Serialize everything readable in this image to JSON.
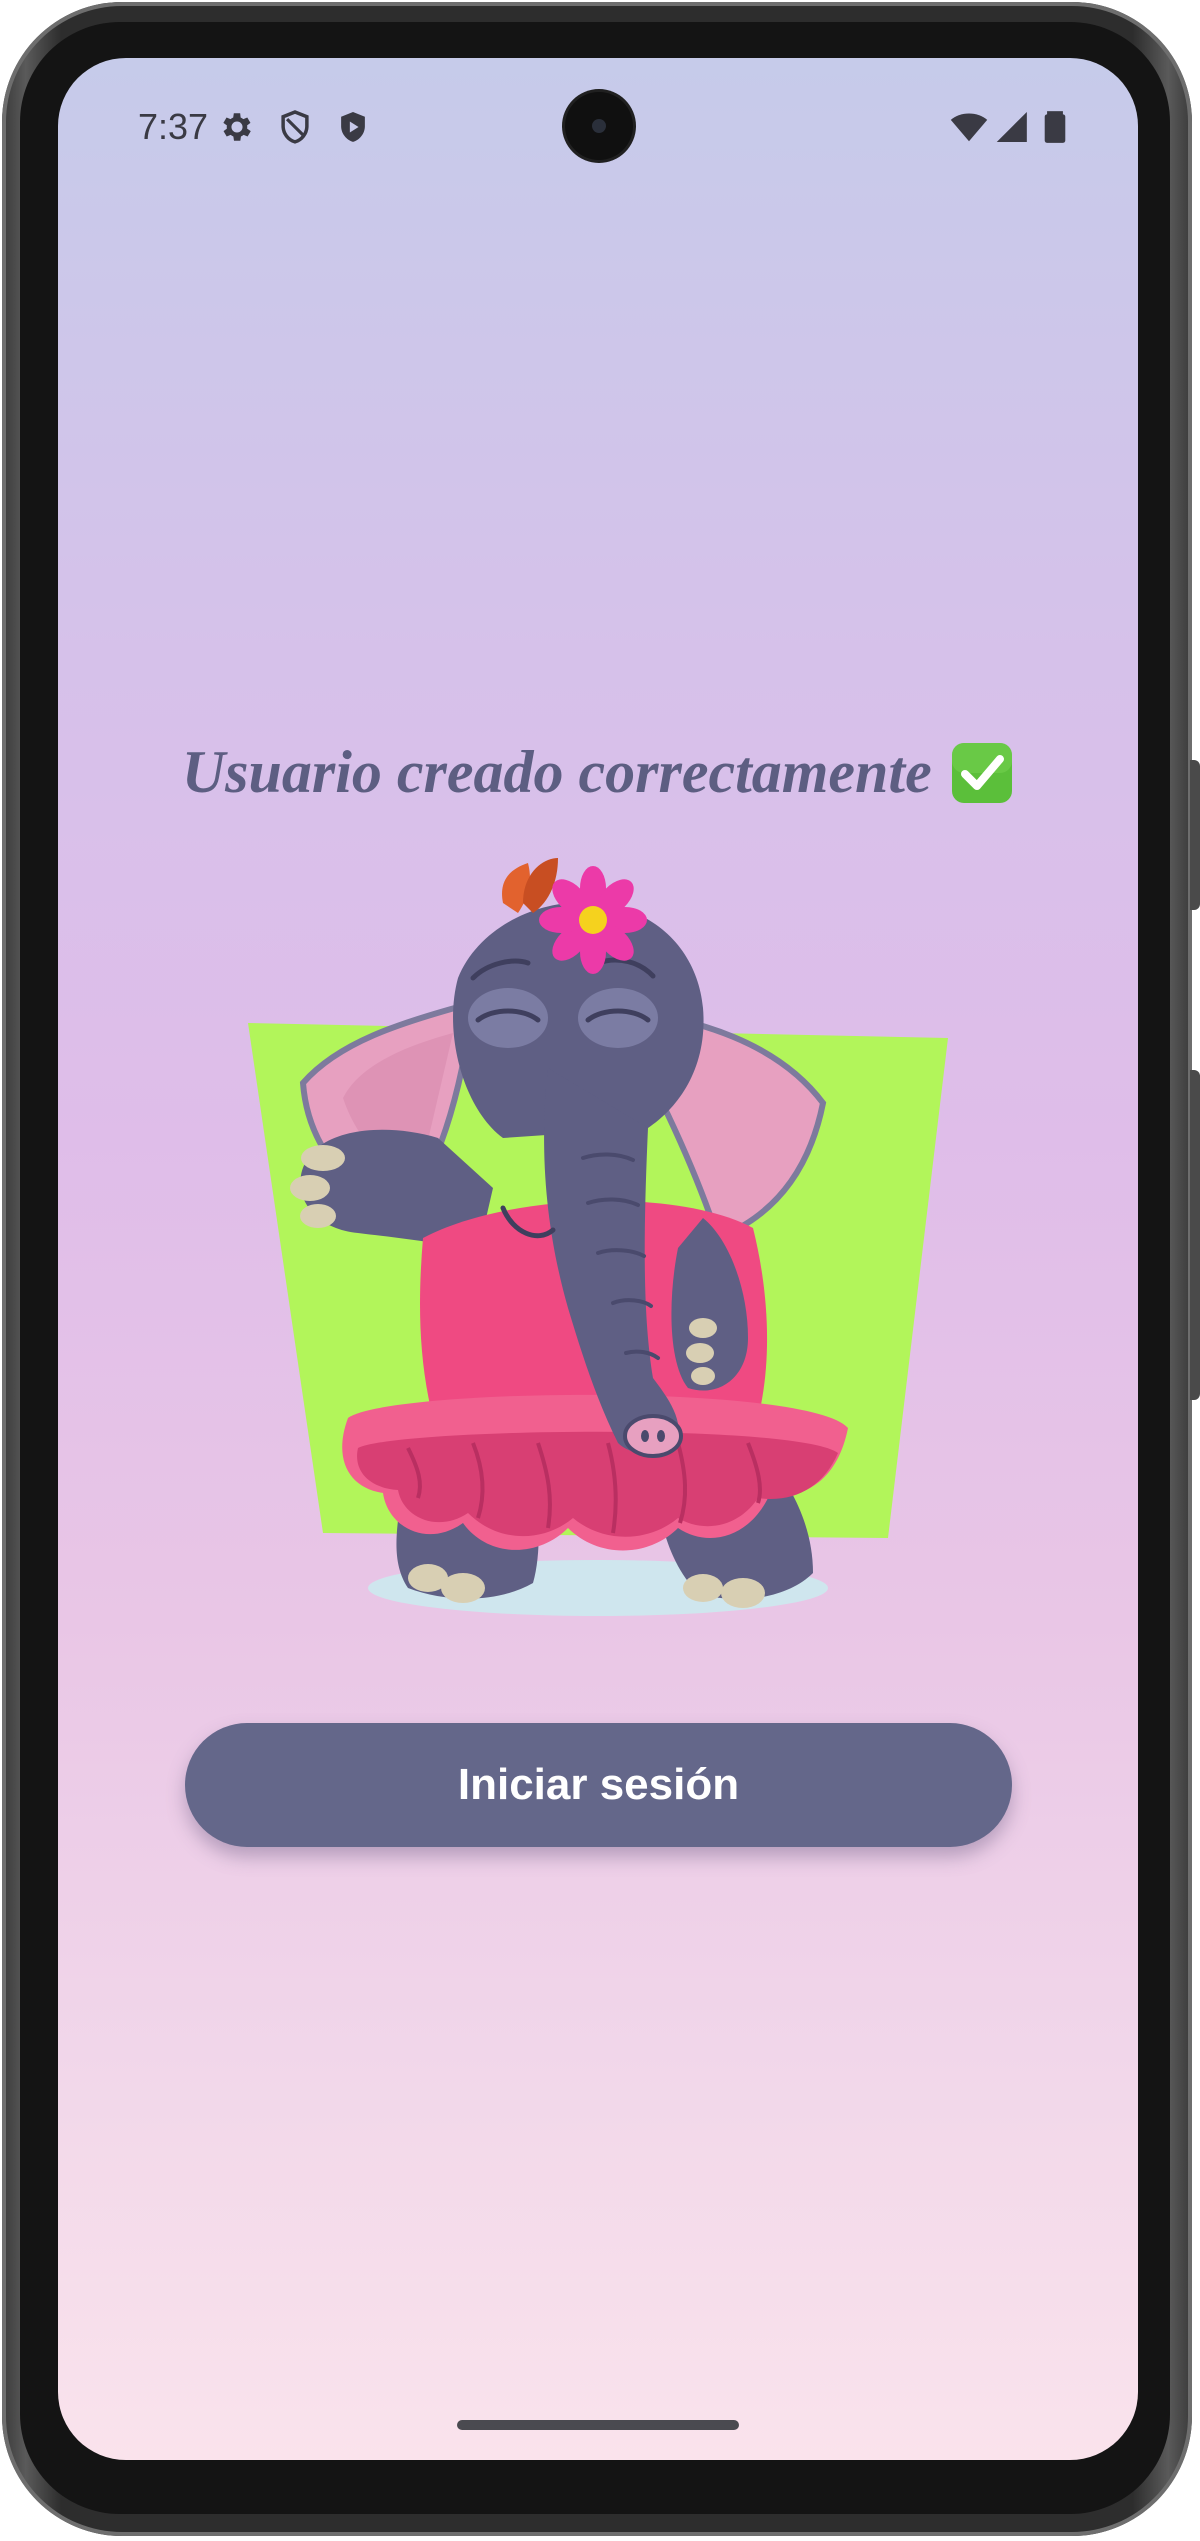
{
  "status_bar": {
    "time": "7:37",
    "left_icons": [
      "gear-icon",
      "shield-outline-icon",
      "shield-play-icon"
    ],
    "right_icons": [
      "wifi-icon",
      "cell-signal-icon",
      "battery-icon"
    ]
  },
  "main": {
    "title": "Usuario creado correctamente",
    "title_emoji_icon": "check-mark-button-icon",
    "illustration": "dancing-elephant-tutu-illustration",
    "login_button_label": "Iniciar sesión"
  },
  "colors": {
    "title": "#5d5e82",
    "button_bg": "#64678a",
    "button_text": "#ffffff",
    "check_green": "#5bbf3a",
    "gradient_top": "#c6cbea",
    "gradient_bottom": "#fae3ec"
  }
}
